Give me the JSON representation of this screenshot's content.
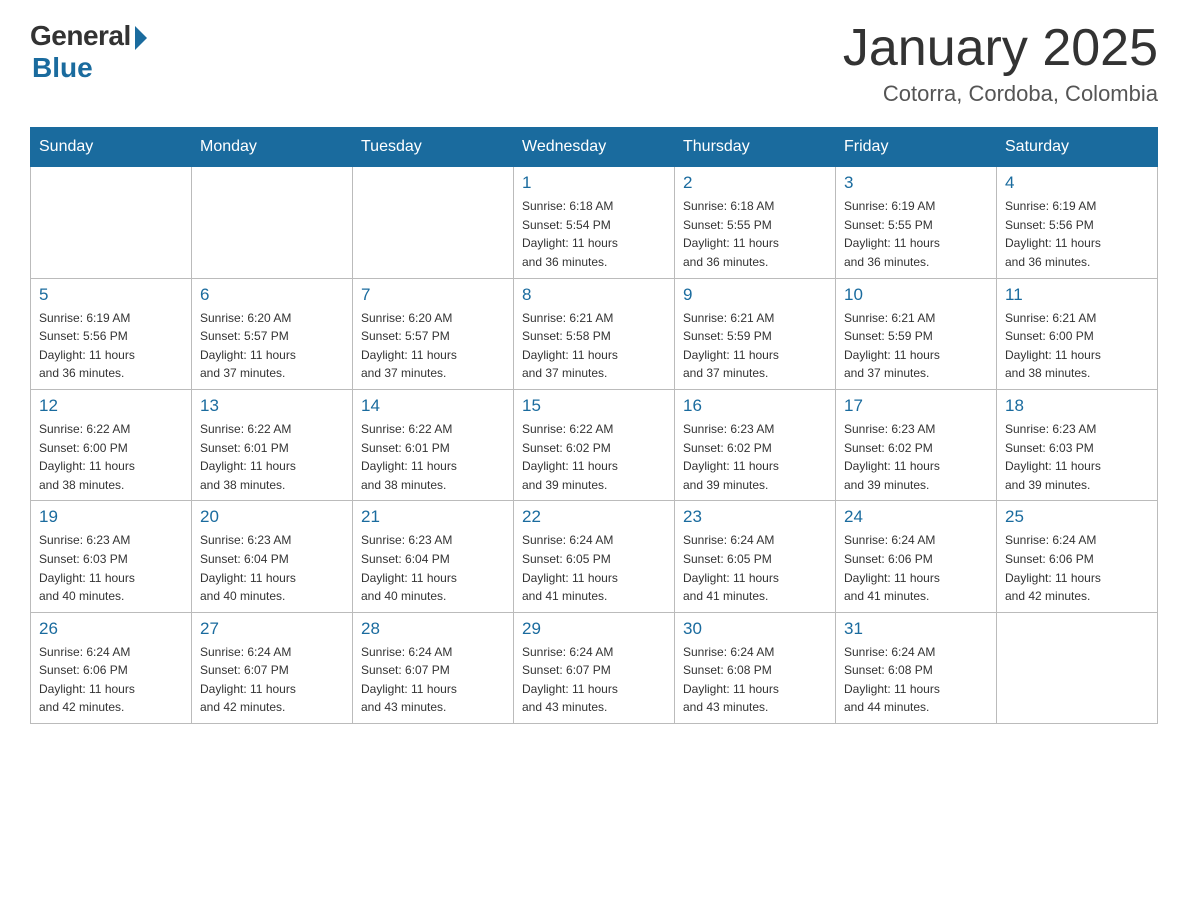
{
  "header": {
    "logo_general": "General",
    "logo_blue": "Blue",
    "month_title": "January 2025",
    "location": "Cotorra, Cordoba, Colombia"
  },
  "days_of_week": [
    "Sunday",
    "Monday",
    "Tuesday",
    "Wednesday",
    "Thursday",
    "Friday",
    "Saturday"
  ],
  "weeks": [
    [
      {
        "day": "",
        "info": ""
      },
      {
        "day": "",
        "info": ""
      },
      {
        "day": "",
        "info": ""
      },
      {
        "day": "1",
        "info": "Sunrise: 6:18 AM\nSunset: 5:54 PM\nDaylight: 11 hours\nand 36 minutes."
      },
      {
        "day": "2",
        "info": "Sunrise: 6:18 AM\nSunset: 5:55 PM\nDaylight: 11 hours\nand 36 minutes."
      },
      {
        "day": "3",
        "info": "Sunrise: 6:19 AM\nSunset: 5:55 PM\nDaylight: 11 hours\nand 36 minutes."
      },
      {
        "day": "4",
        "info": "Sunrise: 6:19 AM\nSunset: 5:56 PM\nDaylight: 11 hours\nand 36 minutes."
      }
    ],
    [
      {
        "day": "5",
        "info": "Sunrise: 6:19 AM\nSunset: 5:56 PM\nDaylight: 11 hours\nand 36 minutes."
      },
      {
        "day": "6",
        "info": "Sunrise: 6:20 AM\nSunset: 5:57 PM\nDaylight: 11 hours\nand 37 minutes."
      },
      {
        "day": "7",
        "info": "Sunrise: 6:20 AM\nSunset: 5:57 PM\nDaylight: 11 hours\nand 37 minutes."
      },
      {
        "day": "8",
        "info": "Sunrise: 6:21 AM\nSunset: 5:58 PM\nDaylight: 11 hours\nand 37 minutes."
      },
      {
        "day": "9",
        "info": "Sunrise: 6:21 AM\nSunset: 5:59 PM\nDaylight: 11 hours\nand 37 minutes."
      },
      {
        "day": "10",
        "info": "Sunrise: 6:21 AM\nSunset: 5:59 PM\nDaylight: 11 hours\nand 37 minutes."
      },
      {
        "day": "11",
        "info": "Sunrise: 6:21 AM\nSunset: 6:00 PM\nDaylight: 11 hours\nand 38 minutes."
      }
    ],
    [
      {
        "day": "12",
        "info": "Sunrise: 6:22 AM\nSunset: 6:00 PM\nDaylight: 11 hours\nand 38 minutes."
      },
      {
        "day": "13",
        "info": "Sunrise: 6:22 AM\nSunset: 6:01 PM\nDaylight: 11 hours\nand 38 minutes."
      },
      {
        "day": "14",
        "info": "Sunrise: 6:22 AM\nSunset: 6:01 PM\nDaylight: 11 hours\nand 38 minutes."
      },
      {
        "day": "15",
        "info": "Sunrise: 6:22 AM\nSunset: 6:02 PM\nDaylight: 11 hours\nand 39 minutes."
      },
      {
        "day": "16",
        "info": "Sunrise: 6:23 AM\nSunset: 6:02 PM\nDaylight: 11 hours\nand 39 minutes."
      },
      {
        "day": "17",
        "info": "Sunrise: 6:23 AM\nSunset: 6:02 PM\nDaylight: 11 hours\nand 39 minutes."
      },
      {
        "day": "18",
        "info": "Sunrise: 6:23 AM\nSunset: 6:03 PM\nDaylight: 11 hours\nand 39 minutes."
      }
    ],
    [
      {
        "day": "19",
        "info": "Sunrise: 6:23 AM\nSunset: 6:03 PM\nDaylight: 11 hours\nand 40 minutes."
      },
      {
        "day": "20",
        "info": "Sunrise: 6:23 AM\nSunset: 6:04 PM\nDaylight: 11 hours\nand 40 minutes."
      },
      {
        "day": "21",
        "info": "Sunrise: 6:23 AM\nSunset: 6:04 PM\nDaylight: 11 hours\nand 40 minutes."
      },
      {
        "day": "22",
        "info": "Sunrise: 6:24 AM\nSunset: 6:05 PM\nDaylight: 11 hours\nand 41 minutes."
      },
      {
        "day": "23",
        "info": "Sunrise: 6:24 AM\nSunset: 6:05 PM\nDaylight: 11 hours\nand 41 minutes."
      },
      {
        "day": "24",
        "info": "Sunrise: 6:24 AM\nSunset: 6:06 PM\nDaylight: 11 hours\nand 41 minutes."
      },
      {
        "day": "25",
        "info": "Sunrise: 6:24 AM\nSunset: 6:06 PM\nDaylight: 11 hours\nand 42 minutes."
      }
    ],
    [
      {
        "day": "26",
        "info": "Sunrise: 6:24 AM\nSunset: 6:06 PM\nDaylight: 11 hours\nand 42 minutes."
      },
      {
        "day": "27",
        "info": "Sunrise: 6:24 AM\nSunset: 6:07 PM\nDaylight: 11 hours\nand 42 minutes."
      },
      {
        "day": "28",
        "info": "Sunrise: 6:24 AM\nSunset: 6:07 PM\nDaylight: 11 hours\nand 43 minutes."
      },
      {
        "day": "29",
        "info": "Sunrise: 6:24 AM\nSunset: 6:07 PM\nDaylight: 11 hours\nand 43 minutes."
      },
      {
        "day": "30",
        "info": "Sunrise: 6:24 AM\nSunset: 6:08 PM\nDaylight: 11 hours\nand 43 minutes."
      },
      {
        "day": "31",
        "info": "Sunrise: 6:24 AM\nSunset: 6:08 PM\nDaylight: 11 hours\nand 44 minutes."
      },
      {
        "day": "",
        "info": ""
      }
    ]
  ]
}
